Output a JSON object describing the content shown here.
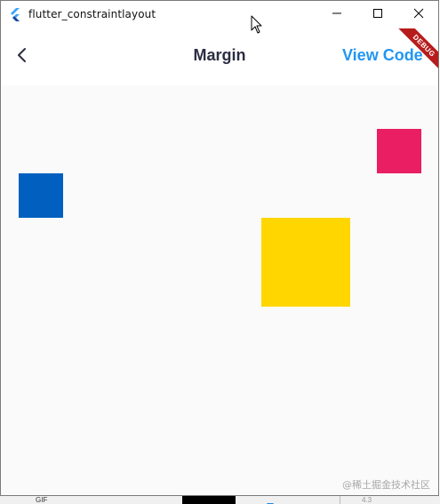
{
  "window": {
    "title": "flutter_constraintlayout",
    "icon": "flutter-logo-icon",
    "controls": {
      "minimize_icon": "minimize-icon",
      "maximize_icon": "maximize-icon",
      "close_icon": "close-icon"
    }
  },
  "appbar": {
    "back_icon": "chevron-left-icon",
    "title": "Margin",
    "action_label": "View Code",
    "debug_banner": "DEBUG"
  },
  "colors": {
    "action": "#2196f3",
    "debug_banner": "#b71c1c",
    "box_blue": "#005fbf",
    "box_pink": "#e91e63",
    "box_yellow": "#ffd600",
    "canvas_background": "#fafafa"
  },
  "taskbar": {
    "left_text": "GIF",
    "field_text": "4.3"
  },
  "watermark": "@稀土掘金技术社区"
}
